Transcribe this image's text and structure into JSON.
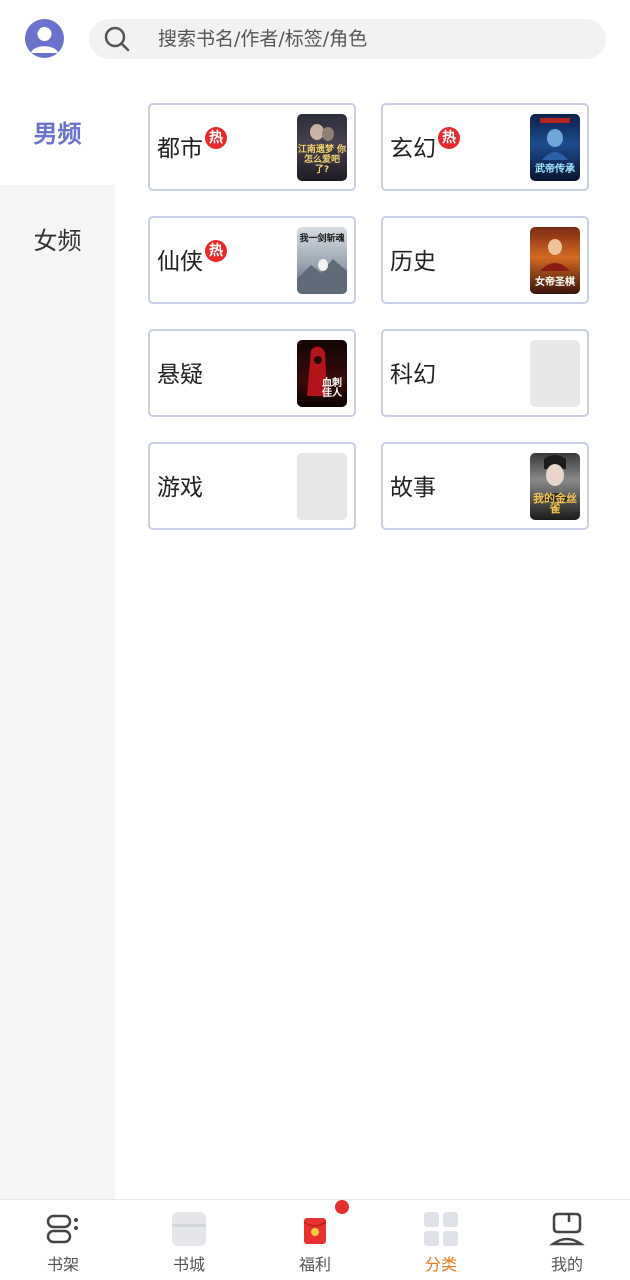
{
  "header": {
    "search_placeholder": "搜索书名/作者/标签/角色"
  },
  "sidebar": {
    "items": [
      {
        "label": "男频",
        "active": true
      },
      {
        "label": "女频",
        "active": false
      }
    ]
  },
  "categories": [
    {
      "label": "都市",
      "hot": true,
      "hot_label": "热",
      "cover": "image",
      "cover_text": "江南遗梦 你怎么爱吧了?"
    },
    {
      "label": "玄幻",
      "hot": true,
      "hot_label": "热",
      "cover": "image",
      "cover_text": "武帝传承"
    },
    {
      "label": "仙侠",
      "hot": true,
      "hot_label": "热",
      "cover": "image",
      "cover_text": "我一剑斩魂"
    },
    {
      "label": "历史",
      "hot": false,
      "cover": "image",
      "cover_text": "女帝圣棋"
    },
    {
      "label": "悬疑",
      "hot": false,
      "cover": "image",
      "cover_text": "血刺佳人"
    },
    {
      "label": "科幻",
      "hot": false,
      "cover": "blank"
    },
    {
      "label": "游戏",
      "hot": false,
      "cover": "blank"
    },
    {
      "label": "故事",
      "hot": false,
      "cover": "image",
      "cover_text": "我的金丝雀"
    }
  ],
  "tabbar": {
    "tabs": [
      {
        "label": "书架",
        "icon": "bookshelf-icon",
        "active": false
      },
      {
        "label": "书城",
        "icon": "bookstore-icon",
        "active": false
      },
      {
        "label": "福利",
        "icon": "welfare-redpacket-icon",
        "active": false,
        "dot": true
      },
      {
        "label": "分类",
        "icon": "category-grid-icon",
        "active": true
      },
      {
        "label": "我的",
        "icon": "profile-icon",
        "active": false
      }
    ],
    "active_color": "#f07a1a"
  },
  "colors": {
    "accent": "#6a72cc",
    "hot_badge": "#e52a2a",
    "card_border": "#c8cfe6"
  }
}
